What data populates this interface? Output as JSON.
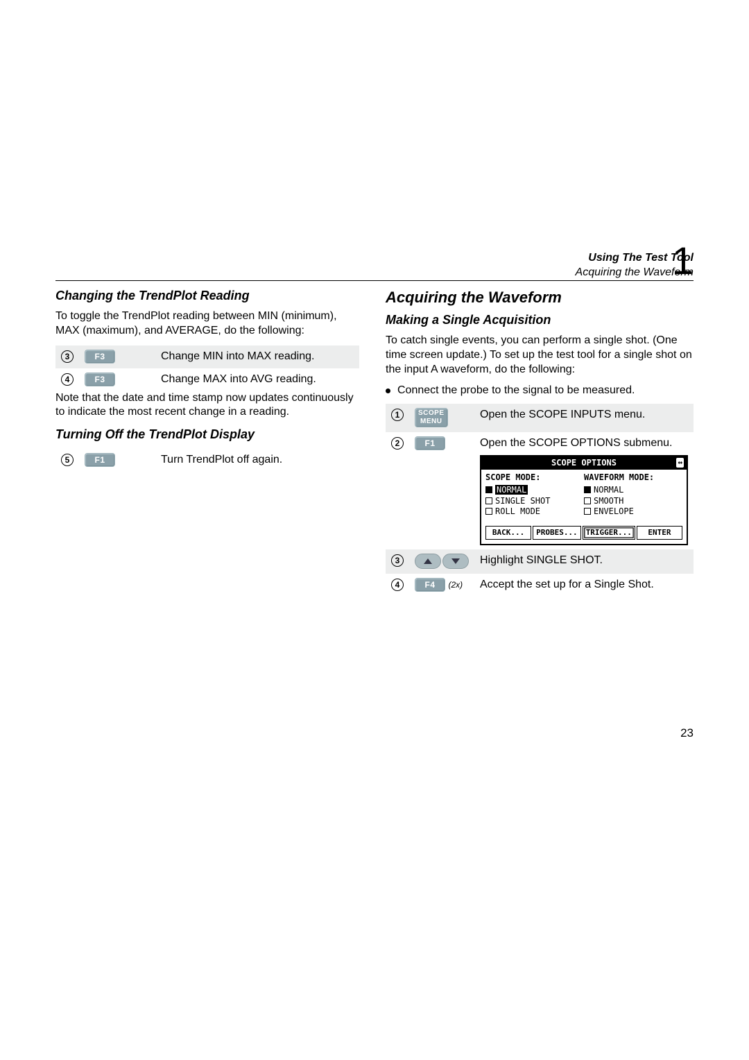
{
  "header": {
    "title": "Using The Test Tool",
    "subtitle": "Acquiring the Waveform",
    "chapter": "1"
  },
  "left": {
    "heading1": "Changing the TrendPlot Reading",
    "intro1": "To toggle the TrendPlot reading between MIN (minimum), MAX (maximum), and AVERAGE, do the following:",
    "steps1": [
      {
        "num": "3",
        "key": "F3",
        "desc": "Change MIN into MAX reading."
      },
      {
        "num": "4",
        "key": "F3",
        "desc": "Change MAX into AVG reading."
      }
    ],
    "note1": "Note that the date and time stamp now updates continuously to indicate the most recent change in a reading.",
    "heading2": "Turning Off the TrendPlot Display",
    "steps2": [
      {
        "num": "5",
        "key": "F1",
        "desc": "Turn TrendPlot off again."
      }
    ]
  },
  "right": {
    "heading": "Acquiring the Waveform",
    "subheading": "Making a Single Acquisition",
    "intro": "To catch single events, you can perform a single shot. (One time screen update.) To set up the test tool for a single shot on the input A waveform, do the following:",
    "bullet": "Connect the probe to the signal to be measured.",
    "steps": [
      {
        "num": "1",
        "key_label": "SCOPE MENU",
        "key_style": "double",
        "desc": "Open the SCOPE INPUTS menu."
      },
      {
        "num": "2",
        "key_label": "F1",
        "desc_line1": "Open the SCOPE OPTIONS submenu."
      },
      {
        "num": "3",
        "arrows": true,
        "desc": "Highlight SINGLE SHOT."
      },
      {
        "num": "4",
        "key_label": "F4",
        "note": "(2x)",
        "desc": "Accept the set up for a Single Shot."
      }
    ],
    "scopebox": {
      "title": "SCOPE OPTIONS",
      "swap": "↔",
      "left_hdr": "SCOPE MODE:",
      "left_items": [
        {
          "fill": true,
          "label": "NORMAL",
          "selected": true
        },
        {
          "fill": false,
          "label": "SINGLE SHOT"
        },
        {
          "fill": false,
          "label": "ROLL MODE"
        }
      ],
      "right_hdr": "WAVEFORM MODE:",
      "right_items": [
        {
          "fill": true,
          "label": "NORMAL"
        },
        {
          "fill": false,
          "label": "SMOOTH"
        },
        {
          "fill": false,
          "label": "ENVELOPE"
        }
      ],
      "tabs": [
        "BACK...",
        "PROBES...",
        "TRIGGER...",
        "ENTER"
      ]
    }
  },
  "page": "23"
}
